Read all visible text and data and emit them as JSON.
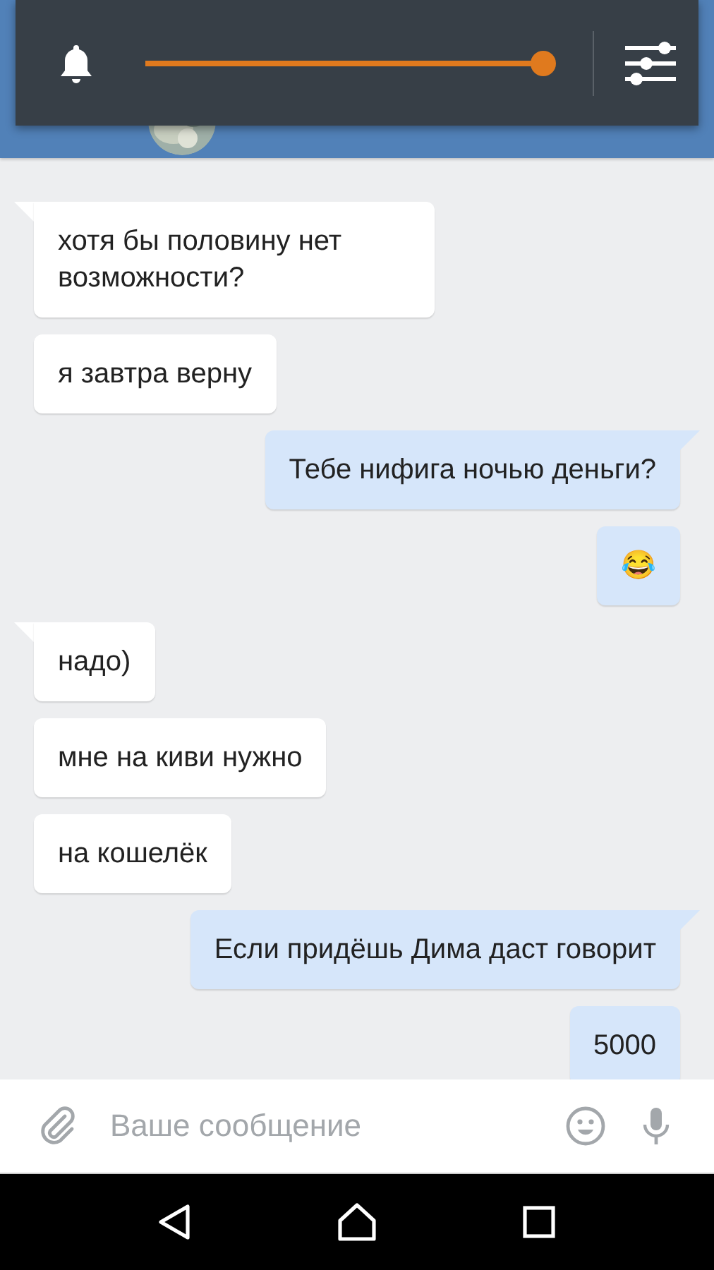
{
  "volume_panel": {
    "level": 1
  },
  "messages": [
    {
      "kind": "incoming",
      "tail": true,
      "text": "хотя бы половину нет возможности?"
    },
    {
      "kind": "incoming",
      "tail": false,
      "text": "я завтра верну"
    },
    {
      "kind": "outgoing",
      "tail": true,
      "text": "Тебе нифига ночью деньги?"
    },
    {
      "kind": "outgoing",
      "tail": false,
      "text": "😂"
    },
    {
      "kind": "incoming",
      "tail": true,
      "text": "надо)"
    },
    {
      "kind": "incoming",
      "tail": false,
      "text": "мне на киви нужно"
    },
    {
      "kind": "incoming",
      "tail": false,
      "text": "на кошелёк"
    },
    {
      "kind": "outgoing",
      "tail": true,
      "text": "Если придёшь Дима даст говорит"
    },
    {
      "kind": "outgoing",
      "tail": false,
      "text": "5000"
    }
  ],
  "composer": {
    "placeholder": "Ваше сообщение"
  }
}
